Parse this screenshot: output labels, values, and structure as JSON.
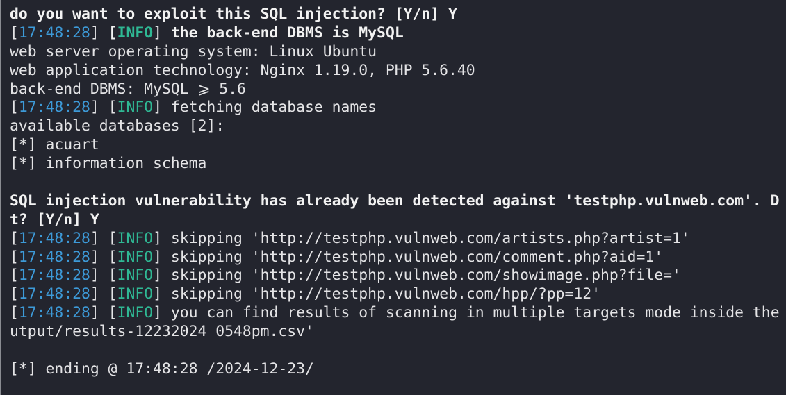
{
  "colors": {
    "background": "#23252e",
    "timestamp": "#3d9ad8",
    "info": "#2fb894",
    "text": "#e4e4e6"
  },
  "lines": {
    "l1": "do you want to exploit this SQL injection? [Y/n] Y",
    "l2": {
      "ts": "17:48:28",
      "level": "INFO",
      "msg": " the back-end DBMS is MySQL"
    },
    "l3": "web server operating system: Linux Ubuntu",
    "l4": "web application technology: Nginx 1.19.0, PHP 5.6.40",
    "l5": "back-end DBMS: MySQL ⩾ 5.6",
    "l6": {
      "ts": "17:48:28",
      "level": "INFO",
      "msg": " fetching database names"
    },
    "l7": "available databases [2]:",
    "l8": "[*] acuart",
    "l9": "[*] information_schema",
    "l11": "SQL injection vulnerability has already been detected against 'testphp.vulnweb.com'. D",
    "l12": "t? [Y/n] Y",
    "l13": {
      "ts": "17:48:28",
      "level": "INFO",
      "msg": " skipping 'http://testphp.vulnweb.com/artists.php?artist=1'"
    },
    "l14": {
      "ts": "17:48:28",
      "level": "INFO",
      "msg": " skipping 'http://testphp.vulnweb.com/comment.php?aid=1'"
    },
    "l15": {
      "ts": "17:48:28",
      "level": "INFO",
      "msg": " skipping 'http://testphp.vulnweb.com/showimage.php?file='"
    },
    "l16": {
      "ts": "17:48:28",
      "level": "INFO",
      "msg": " skipping 'http://testphp.vulnweb.com/hpp/?pp=12'"
    },
    "l17": {
      "ts": "17:48:28",
      "level": "INFO",
      "msg": " you can find results of scanning in multiple targets mode inside the"
    },
    "l18": "utput/results-12232024_0548pm.csv'",
    "l20": "[*] ending @ 17:48:28 /2024-12-23/"
  }
}
